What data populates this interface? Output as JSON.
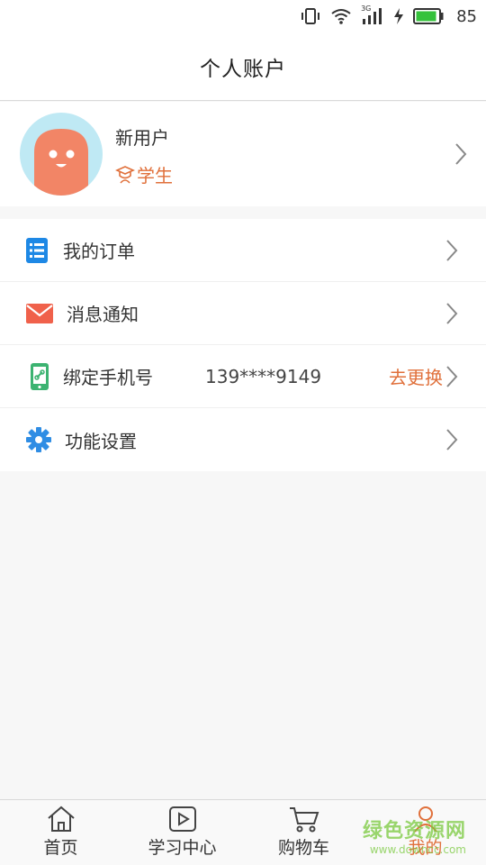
{
  "status_bar": {
    "network": "3G",
    "battery": "85"
  },
  "header": {
    "title": "个人账户"
  },
  "profile": {
    "name": "新用户",
    "role": "学生"
  },
  "menu": {
    "orders": "我的订单",
    "messages": "消息通知",
    "bind_phone": "绑定手机号",
    "phone_number": "139****9149",
    "change_label": "去更换",
    "settings": "功能设置"
  },
  "bottom_nav": {
    "items": [
      {
        "label": "首页",
        "icon": "home-icon"
      },
      {
        "label": "学习中心",
        "icon": "play-icon"
      },
      {
        "label": "购物车",
        "icon": "cart-icon"
      },
      {
        "label": "我的",
        "icon": "user-icon"
      }
    ],
    "active_index": 3
  },
  "watermark": {
    "main": "绿色资源网",
    "sub": "www.downcc.com"
  },
  "colors": {
    "accent": "#e0703b",
    "blue": "#1e88e5",
    "green": "#3cb371",
    "red": "#f0614b"
  }
}
